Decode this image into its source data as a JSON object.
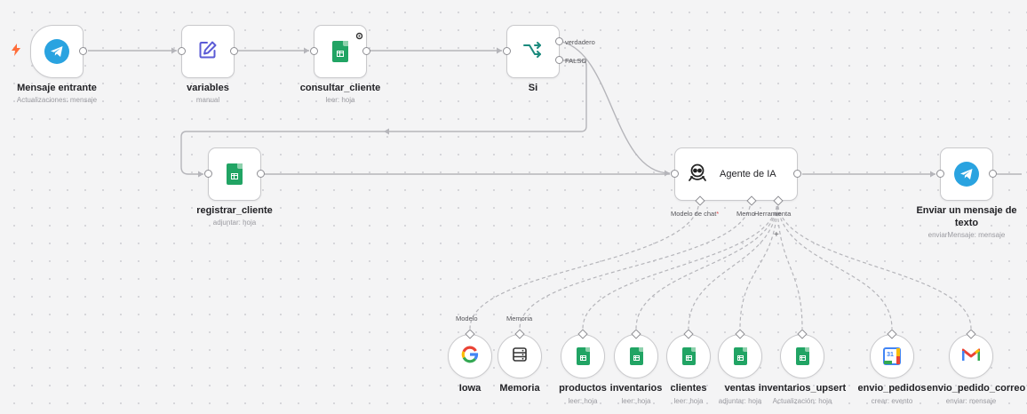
{
  "nodes": {
    "mensaje_entrante": {
      "title": "Mensaje entrante",
      "subtitle": "Actualizaciones: mensaje",
      "icon": "telegram-icon"
    },
    "variables": {
      "title": "variables",
      "subtitle": "manual",
      "icon": "edit-pencil-icon"
    },
    "consultar_cliente": {
      "title": "consultar_cliente",
      "subtitle": "leer: hoja",
      "icon": "google-sheets-icon"
    },
    "si": {
      "title": "Si",
      "icon": "branch-icon",
      "true_label": "verdadero",
      "false_label": "FALSO"
    },
    "registrar_cliente": {
      "title": "registrar_cliente",
      "subtitle": "adjuntar: hoja",
      "icon": "google-sheets-icon"
    },
    "agente": {
      "title": "Agente de IA",
      "icon": "robot-icon",
      "port_model": "Modelo de chat",
      "port_model_required": "*",
      "port_memory": "Memo",
      "port_tool": "Herramienta"
    },
    "enviar": {
      "title_line1": "Enviar un mensaje de",
      "title_line2": "texto",
      "subtitle": "enviarMensaje: mensaje",
      "icon": "telegram-icon"
    }
  },
  "sub_nodes": [
    {
      "title": "Iowa",
      "subtitle": "",
      "above": "Modelo",
      "icon": "google-icon"
    },
    {
      "title": "Memoria",
      "subtitle": "",
      "above": "Memoria",
      "icon": "database-icon"
    },
    {
      "title": "productos",
      "subtitle": "leer: hoja",
      "above": "",
      "icon": "google-sheets-icon"
    },
    {
      "title": "inventarios",
      "subtitle": "leer: hoja",
      "above": "",
      "icon": "google-sheets-icon"
    },
    {
      "title": "clientes",
      "subtitle": "leer: hoja",
      "above": "",
      "icon": "google-sheets-icon"
    },
    {
      "title": "ventas",
      "subtitle": "adjuntar: hoja",
      "above": "",
      "icon": "google-sheets-icon"
    },
    {
      "title": "inventarios_upsert",
      "subtitle": "Actualización: hoja",
      "above": "",
      "icon": "google-sheets-icon"
    },
    {
      "title": "envio_pedidos",
      "subtitle": "crear: evento",
      "above": "",
      "icon": "google-calendar-icon",
      "calendar_day": "31"
    },
    {
      "title": "envio_pedido_correo",
      "subtitle": "enviar: mensaje",
      "above": "",
      "icon": "gmail-icon"
    }
  ],
  "add_tool_symbol": "+",
  "colors": {
    "telegram": "#2aa3e0",
    "sheets": "#21a464",
    "edit_icon": "#5b5bd6",
    "branch_icon": "#1b8a7d",
    "trigger_bolt": "#ff6d3a",
    "edge": "#b5b5ba",
    "required": "#e5484d"
  }
}
